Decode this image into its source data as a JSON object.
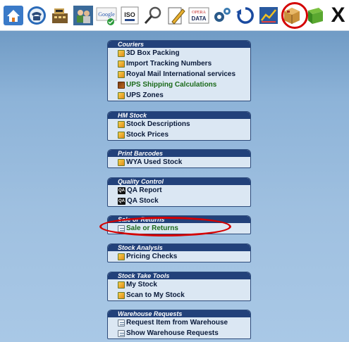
{
  "toolbar": {
    "icons": [
      {
        "name": "home-icon"
      },
      {
        "name": "telephone-icon"
      },
      {
        "name": "cash-register-icon"
      },
      {
        "name": "users-icon"
      },
      {
        "name": "google-icon",
        "label": "Google"
      },
      {
        "name": "iso-icon",
        "label": "ISO"
      },
      {
        "name": "magnifier-icon"
      },
      {
        "name": "edit-document-icon"
      },
      {
        "name": "opera-data-icon",
        "label_top": "OPERA",
        "label_bottom": "DATA"
      },
      {
        "name": "gears-icon"
      },
      {
        "name": "refresh-icon"
      },
      {
        "name": "chart-icon"
      },
      {
        "name": "package-icon"
      },
      {
        "name": "green-book-icon"
      },
      {
        "name": "close-icon",
        "label": "X"
      }
    ]
  },
  "panels": {
    "couriers": {
      "title": "Couriers",
      "items": [
        "3D Box Packing",
        "Import Tracking Numbers",
        "Royal Mail International services",
        "UPS Shipping Calculations",
        "UPS Zones"
      ]
    },
    "hm_stock": {
      "title": "HM Stock",
      "items": [
        "Stock Descriptions",
        "Stock Prices"
      ]
    },
    "print_barcodes": {
      "title": "Print Barcodes",
      "items": [
        "WYA Used Stock"
      ]
    },
    "quality_control": {
      "title": "Quality Control",
      "qa_badge": "QA",
      "items": [
        "QA Report",
        "QA Stock"
      ]
    },
    "sale_returns": {
      "title": "Sale or Returns",
      "items": [
        "Sale or Returns"
      ]
    },
    "stock_analysis": {
      "title": "Stock Analysis",
      "items": [
        "Pricing Checks"
      ]
    },
    "stock_take": {
      "title": "Stock Take Tools",
      "items": [
        "My Stock",
        "Scan to My Stock"
      ]
    },
    "warehouse": {
      "title": "Warehouse Requests",
      "items": [
        "Request Item from Warehouse",
        "Show Warehouse Requests"
      ]
    }
  },
  "colors": {
    "panel_header": "#22417a",
    "panel_body": "#dbe7f3",
    "annotation_red": "#d40000",
    "ups_item_green": "#1a6a1a"
  }
}
